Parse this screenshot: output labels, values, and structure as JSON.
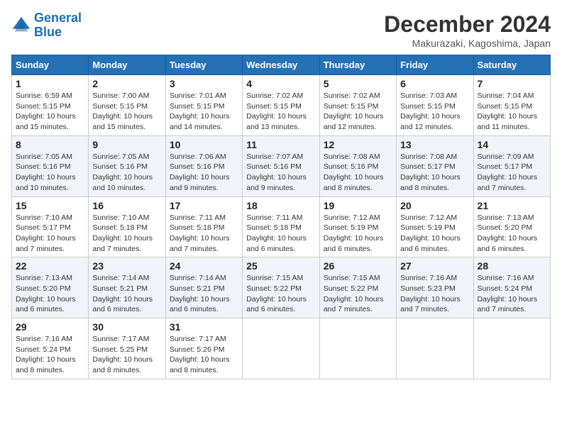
{
  "logo": {
    "line1": "General",
    "line2": "Blue"
  },
  "title": "December 2024",
  "subtitle": "Makurazaki, Kagoshima, Japan",
  "days_header": [
    "Sunday",
    "Monday",
    "Tuesday",
    "Wednesday",
    "Thursday",
    "Friday",
    "Saturday"
  ],
  "weeks": [
    [
      {
        "day": "1",
        "info": "Sunrise: 6:59 AM\nSunset: 5:15 PM\nDaylight: 10 hours\nand 15 minutes."
      },
      {
        "day": "2",
        "info": "Sunrise: 7:00 AM\nSunset: 5:15 PM\nDaylight: 10 hours\nand 15 minutes."
      },
      {
        "day": "3",
        "info": "Sunrise: 7:01 AM\nSunset: 5:15 PM\nDaylight: 10 hours\nand 14 minutes."
      },
      {
        "day": "4",
        "info": "Sunrise: 7:02 AM\nSunset: 5:15 PM\nDaylight: 10 hours\nand 13 minutes."
      },
      {
        "day": "5",
        "info": "Sunrise: 7:02 AM\nSunset: 5:15 PM\nDaylight: 10 hours\nand 12 minutes."
      },
      {
        "day": "6",
        "info": "Sunrise: 7:03 AM\nSunset: 5:15 PM\nDaylight: 10 hours\nand 12 minutes."
      },
      {
        "day": "7",
        "info": "Sunrise: 7:04 AM\nSunset: 5:15 PM\nDaylight: 10 hours\nand 11 minutes."
      }
    ],
    [
      {
        "day": "8",
        "info": "Sunrise: 7:05 AM\nSunset: 5:16 PM\nDaylight: 10 hours\nand 10 minutes."
      },
      {
        "day": "9",
        "info": "Sunrise: 7:05 AM\nSunset: 5:16 PM\nDaylight: 10 hours\nand 10 minutes."
      },
      {
        "day": "10",
        "info": "Sunrise: 7:06 AM\nSunset: 5:16 PM\nDaylight: 10 hours\nand 9 minutes."
      },
      {
        "day": "11",
        "info": "Sunrise: 7:07 AM\nSunset: 5:16 PM\nDaylight: 10 hours\nand 9 minutes."
      },
      {
        "day": "12",
        "info": "Sunrise: 7:08 AM\nSunset: 5:16 PM\nDaylight: 10 hours\nand 8 minutes."
      },
      {
        "day": "13",
        "info": "Sunrise: 7:08 AM\nSunset: 5:17 PM\nDaylight: 10 hours\nand 8 minutes."
      },
      {
        "day": "14",
        "info": "Sunrise: 7:09 AM\nSunset: 5:17 PM\nDaylight: 10 hours\nand 7 minutes."
      }
    ],
    [
      {
        "day": "15",
        "info": "Sunrise: 7:10 AM\nSunset: 5:17 PM\nDaylight: 10 hours\nand 7 minutes."
      },
      {
        "day": "16",
        "info": "Sunrise: 7:10 AM\nSunset: 5:18 PM\nDaylight: 10 hours\nand 7 minutes."
      },
      {
        "day": "17",
        "info": "Sunrise: 7:11 AM\nSunset: 5:18 PM\nDaylight: 10 hours\nand 7 minutes."
      },
      {
        "day": "18",
        "info": "Sunrise: 7:11 AM\nSunset: 5:18 PM\nDaylight: 10 hours\nand 6 minutes."
      },
      {
        "day": "19",
        "info": "Sunrise: 7:12 AM\nSunset: 5:19 PM\nDaylight: 10 hours\nand 6 minutes."
      },
      {
        "day": "20",
        "info": "Sunrise: 7:12 AM\nSunset: 5:19 PM\nDaylight: 10 hours\nand 6 minutes."
      },
      {
        "day": "21",
        "info": "Sunrise: 7:13 AM\nSunset: 5:20 PM\nDaylight: 10 hours\nand 6 minutes."
      }
    ],
    [
      {
        "day": "22",
        "info": "Sunrise: 7:13 AM\nSunset: 5:20 PM\nDaylight: 10 hours\nand 6 minutes."
      },
      {
        "day": "23",
        "info": "Sunrise: 7:14 AM\nSunset: 5:21 PM\nDaylight: 10 hours\nand 6 minutes."
      },
      {
        "day": "24",
        "info": "Sunrise: 7:14 AM\nSunset: 5:21 PM\nDaylight: 10 hours\nand 6 minutes."
      },
      {
        "day": "25",
        "info": "Sunrise: 7:15 AM\nSunset: 5:22 PM\nDaylight: 10 hours\nand 6 minutes."
      },
      {
        "day": "26",
        "info": "Sunrise: 7:15 AM\nSunset: 5:22 PM\nDaylight: 10 hours\nand 7 minutes."
      },
      {
        "day": "27",
        "info": "Sunrise: 7:16 AM\nSunset: 5:23 PM\nDaylight: 10 hours\nand 7 minutes."
      },
      {
        "day": "28",
        "info": "Sunrise: 7:16 AM\nSunset: 5:24 PM\nDaylight: 10 hours\nand 7 minutes."
      }
    ],
    [
      {
        "day": "29",
        "info": "Sunrise: 7:16 AM\nSunset: 5:24 PM\nDaylight: 10 hours\nand 8 minutes."
      },
      {
        "day": "30",
        "info": "Sunrise: 7:17 AM\nSunset: 5:25 PM\nDaylight: 10 hours\nand 8 minutes."
      },
      {
        "day": "31",
        "info": "Sunrise: 7:17 AM\nSunset: 5:26 PM\nDaylight: 10 hours\nand 8 minutes."
      },
      {
        "day": "",
        "info": ""
      },
      {
        "day": "",
        "info": ""
      },
      {
        "day": "",
        "info": ""
      },
      {
        "day": "",
        "info": ""
      }
    ]
  ]
}
